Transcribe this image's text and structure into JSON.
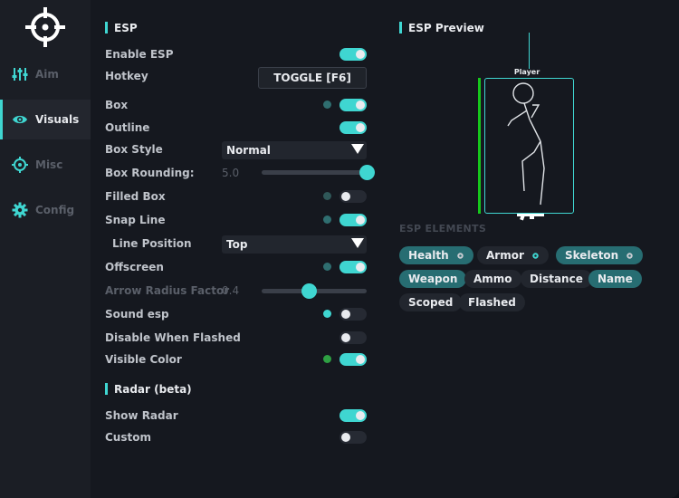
{
  "colors": {
    "accent": "#3fd6d1",
    "health": "#16c81c",
    "visible_dot": "#2ea043",
    "muted_dot": "#2f6e70"
  },
  "nav": [
    {
      "label": "Aim",
      "icon": "sliders-icon",
      "active": false
    },
    {
      "label": "Visuals",
      "icon": "eye-icon",
      "active": true
    },
    {
      "label": "Misc",
      "icon": "target-icon",
      "active": false
    },
    {
      "label": "Config",
      "icon": "gear-icon",
      "active": false
    }
  ],
  "esp": {
    "title": "ESP",
    "enable_esp": {
      "label": "Enable ESP",
      "on": true
    },
    "hotkey": {
      "label": "Hotkey",
      "value": "TOGGLE [F6]"
    },
    "box": {
      "label": "Box",
      "on": true
    },
    "outline": {
      "label": "Outline",
      "on": true
    },
    "box_style": {
      "label": "Box Style",
      "value": "Normal"
    },
    "box_rounding": {
      "label": "Box Rounding:",
      "value": "5.0",
      "fraction": 1.0
    },
    "filled_box": {
      "label": "Filled Box",
      "on": false
    },
    "snap_line": {
      "label": "Snap Line",
      "on": true
    },
    "line_position": {
      "label": "Line Position",
      "value": "Top"
    },
    "offscreen": {
      "label": "Offscreen",
      "on": true
    },
    "arrow_radius": {
      "label": "Arrow Radius Factor",
      "value": "0.4",
      "fraction": 0.45
    },
    "sound_esp": {
      "label": "Sound esp",
      "on": false
    },
    "disable_flashed": {
      "label": "Disable When Flashed",
      "on": false
    },
    "visible_color": {
      "label": "Visible Color",
      "on": true
    }
  },
  "radar": {
    "title": "Radar (beta)",
    "show_radar": {
      "label": "Show Radar",
      "on": true
    },
    "custom": {
      "label": "Custom",
      "on": false
    }
  },
  "preview": {
    "title": "ESP Preview",
    "player_name": "Player",
    "elements_title": "ESP ELEMENTS",
    "chips": [
      {
        "label": "Health",
        "on": true,
        "gear": true
      },
      {
        "label": "Armor",
        "on": false,
        "gear": true
      },
      {
        "label": "Skeleton",
        "on": true,
        "gear": true
      },
      {
        "label": "Weapon",
        "on": true,
        "gear": false
      },
      {
        "label": "Ammo",
        "on": false,
        "gear": false
      },
      {
        "label": "Distance",
        "on": false,
        "gear": false
      },
      {
        "label": "Name",
        "on": true,
        "gear": false
      },
      {
        "label": "Scoped",
        "on": false,
        "gear": false
      },
      {
        "label": "Flashed",
        "on": false,
        "gear": false
      }
    ]
  }
}
